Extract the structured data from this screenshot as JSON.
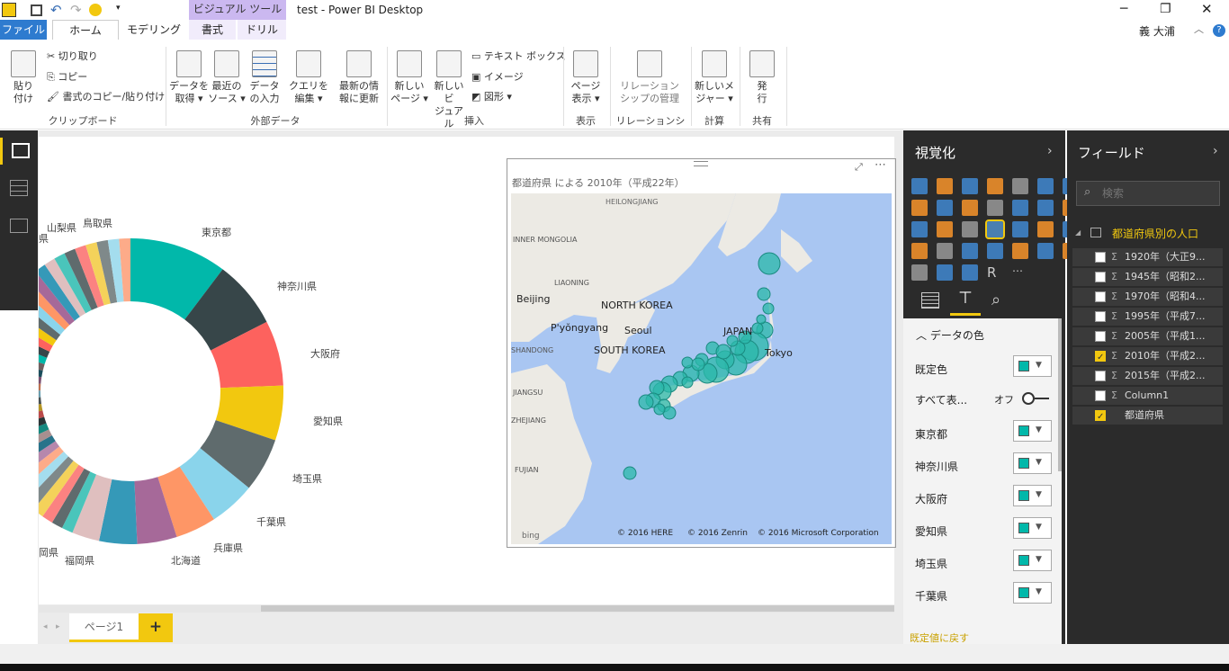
{
  "window": {
    "title": "test - Power BI Desktop",
    "contextual_tab": "ビジュアル ツール",
    "user": "義 大浦"
  },
  "menu": {
    "file": "ファイル",
    "home": "ホーム",
    "modeling": "モデリング",
    "format": "書式",
    "drill": "ドリル"
  },
  "ribbon": {
    "paste": [
      "貼り",
      "付け"
    ],
    "cut": "切り取り",
    "copy": "コピー",
    "format_painter": "書式のコピー/貼り付け",
    "group_clipboard": "クリップボード",
    "get_data": [
      "データを",
      "取得 ▾"
    ],
    "recent_sources": [
      "最近の",
      "ソース ▾"
    ],
    "enter_data": [
      "データ",
      "の入力"
    ],
    "group_external": "外部データ",
    "edit_queries": [
      "クエリを",
      "編集 ▾"
    ],
    "refresh": [
      "最新の情",
      "報に更新"
    ],
    "new_page": [
      "新しい",
      "ページ ▾"
    ],
    "new_visual": [
      "新しいビ",
      "ジュアル"
    ],
    "text_box": "テキスト ボックス",
    "image": "イメージ",
    "shapes": "図形 ▾",
    "group_insert": "挿入",
    "page_view": [
      "ページ",
      "表示 ▾"
    ],
    "group_view": "表示",
    "manage_rel": [
      "リレーション",
      "シップの管理"
    ],
    "group_rel": "リレーションシップ",
    "new_measure": [
      "新しいメ",
      "ジャー ▾"
    ],
    "group_calc": "計算",
    "publish": [
      "発",
      "行"
    ],
    "group_share": "共有"
  },
  "map": {
    "title": "都道府県 による 2010年（平成22年）",
    "labels": [
      "HEILONGJIANG",
      "INNER MONGOLIA",
      "LIAONING",
      "Beijing",
      "NORTH KOREA",
      "P'yŏngyang",
      "Seoul",
      "SOUTH KOREA",
      "SHANDONG",
      "JIANGSU",
      "JAPAN",
      "Tokyo",
      "ZHEJIANG",
      "FUJIAN"
    ],
    "copyright": [
      "© 2016 HERE",
      "© 2016 Zenrin",
      "© 2016 Microsoft Corporation"
    ],
    "bing": "bing"
  },
  "donut": {
    "labels": [
      "東京都",
      "神奈川県",
      "大阪府",
      "愛知県",
      "埼玉県",
      "千葉県",
      "兵庫県",
      "北海道",
      "福岡県",
      "岡県",
      "山梨県",
      "鳥取県",
      "県"
    ],
    "colors": [
      "#01b8aa",
      "#374649",
      "#fd625e",
      "#f2c80f",
      "#5f6b6d",
      "#8ad4eb",
      "#fe9666",
      "#a66999",
      "#3599b8",
      "#dfbfbf",
      "#4ac5bb",
      "#5f6b6d",
      "#fb8281",
      "#f4d25a",
      "#7f898a",
      "#a4ddee",
      "#fdab89",
      "#b687ac",
      "#28738a",
      "#a78f8f",
      "#168980",
      "#293537",
      "#bb4a4a",
      "#b59525",
      "#475052",
      "#6a9fb0",
      "#bd7150",
      "#7b4f71",
      "#1b4d5c",
      "#706060"
    ]
  },
  "pages": {
    "page1": "ページ1",
    "add": "+"
  },
  "viz_pane": {
    "title": "視覚化",
    "section": "データの色",
    "default_color": "既定色",
    "show_all": "すべて表...",
    "toggle": "オフ",
    "rows": [
      "東京都",
      "神奈川県",
      "大阪府",
      "愛知県",
      "埼玉県",
      "千葉県"
    ],
    "reset": "既定値に戻す"
  },
  "fields_pane": {
    "title": "フィールド",
    "search_placeholder": "検索",
    "table": "都道府県別の人口",
    "fields": [
      "1920年（大正9...",
      "1945年（昭和2...",
      "1970年（昭和4...",
      "1995年（平成7...",
      "2005年（平成1...",
      "2010年（平成2...",
      "2015年（平成2...",
      "Column1",
      "都道府県"
    ],
    "checked": [
      false,
      false,
      false,
      false,
      false,
      true,
      false,
      false,
      true
    ]
  }
}
